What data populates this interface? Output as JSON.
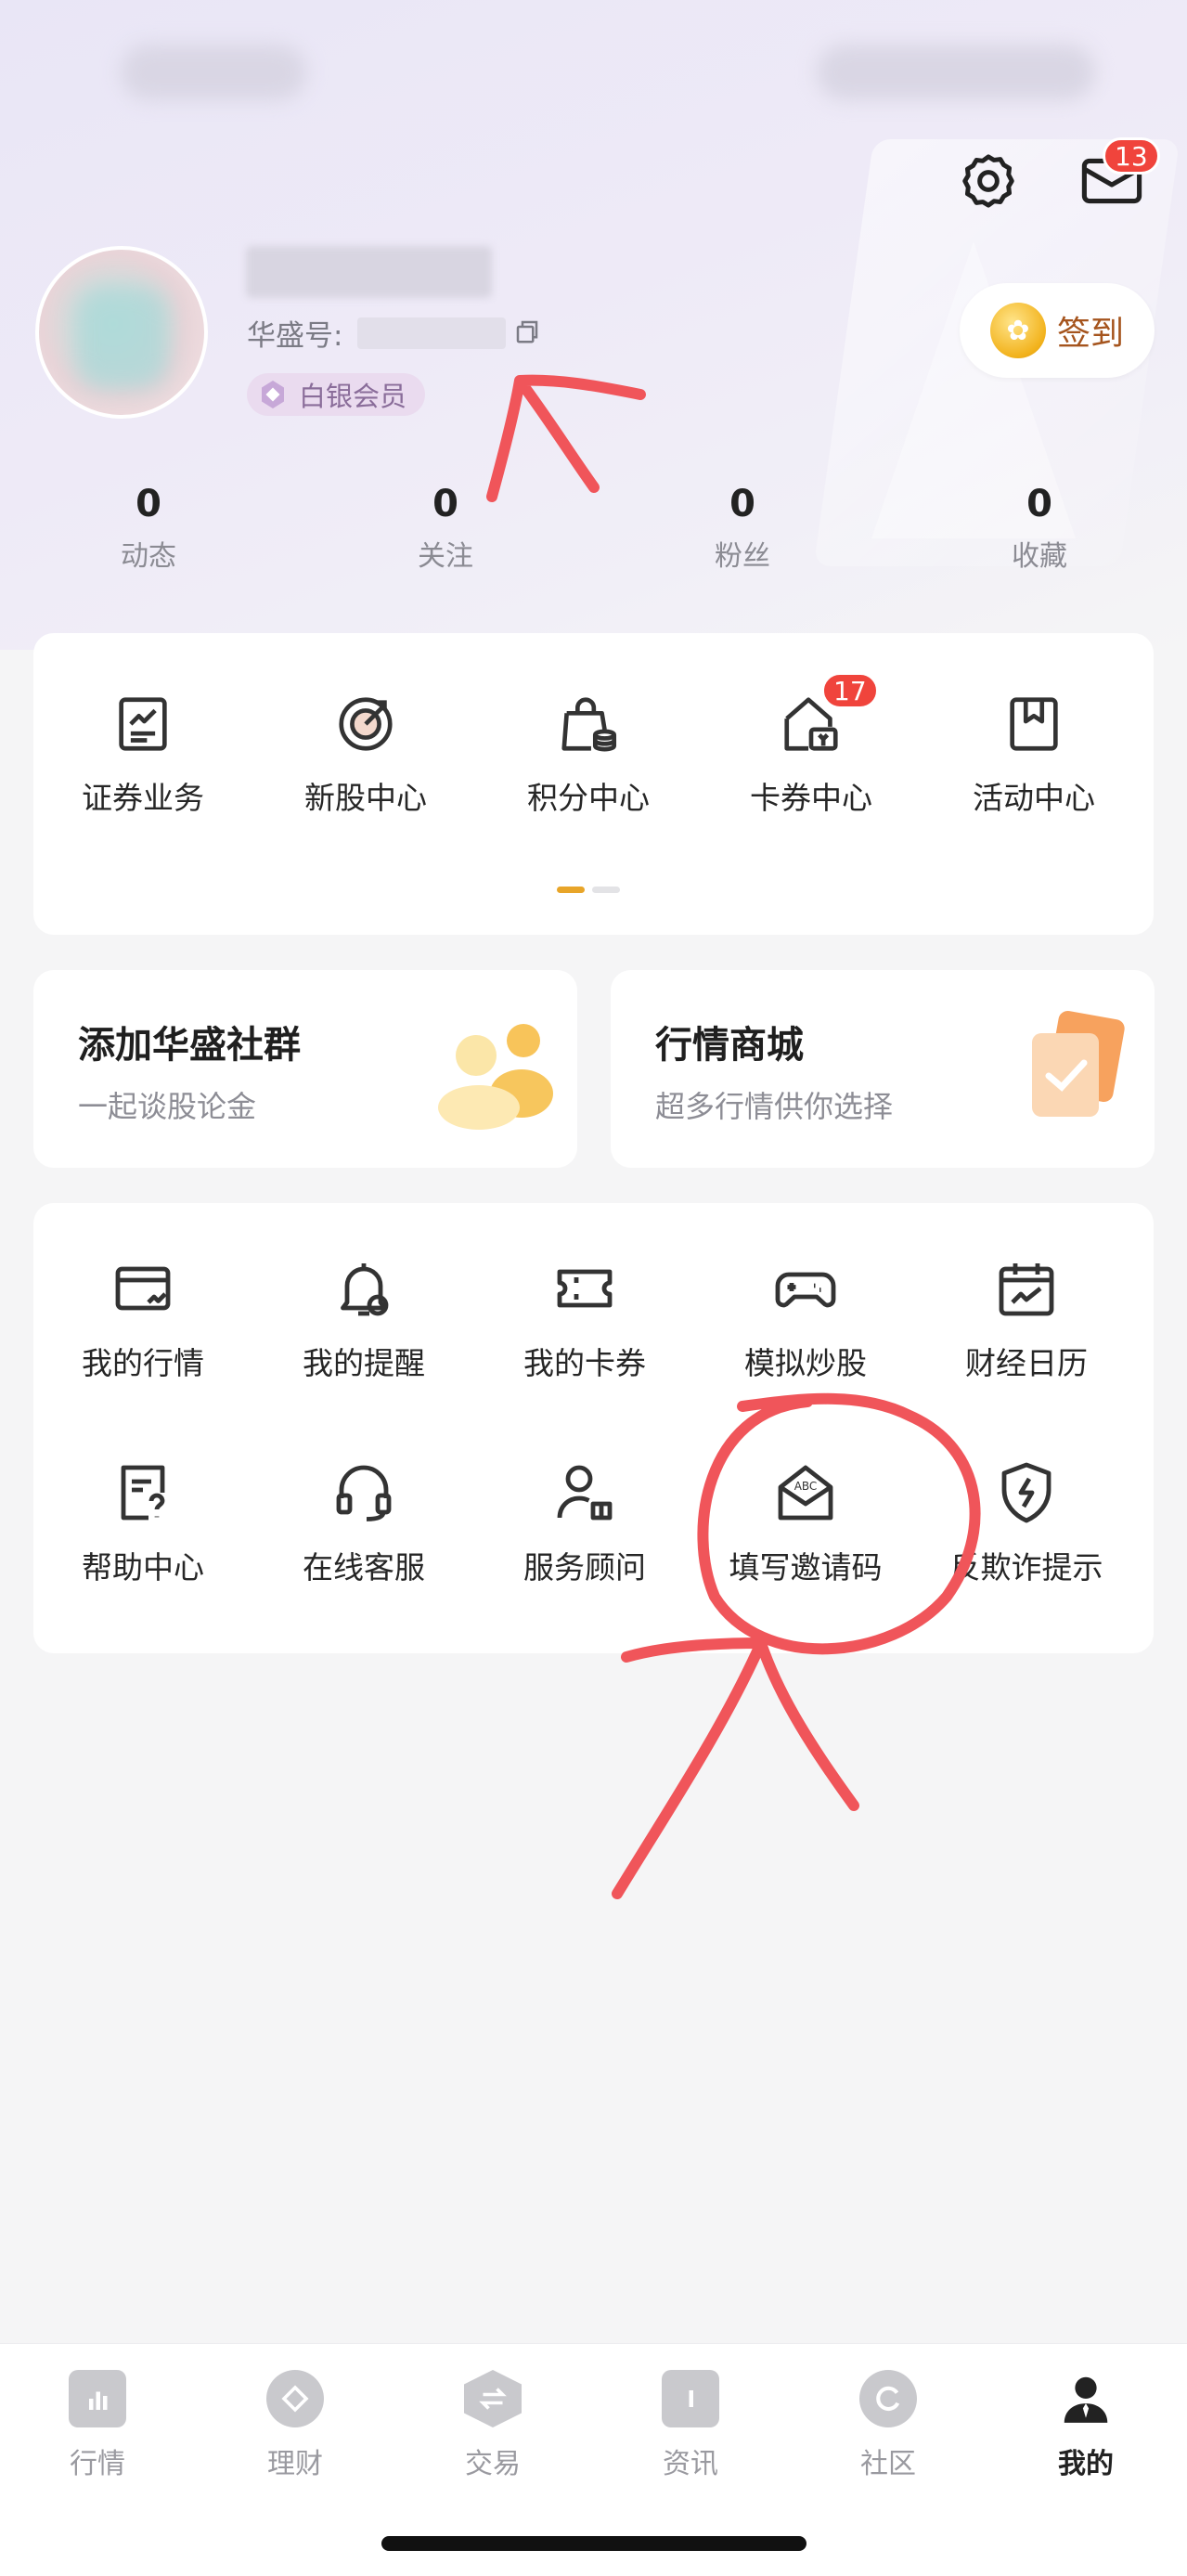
{
  "header": {
    "settings_icon": "gear-icon",
    "mail_icon": "mail-icon",
    "mail_badge": "13"
  },
  "profile": {
    "id_label": "华盛号:",
    "member_level": "白银会员",
    "checkin_label": "签到",
    "stats": [
      {
        "value": "0",
        "label": "动态"
      },
      {
        "value": "0",
        "label": "关注"
      },
      {
        "value": "0",
        "label": "粉丝"
      },
      {
        "value": "0",
        "label": "收藏"
      }
    ]
  },
  "services": {
    "items": [
      {
        "label": "证券业务",
        "icon": "document-chart-icon"
      },
      {
        "label": "新股中心",
        "icon": "target-icon"
      },
      {
        "label": "积分中心",
        "icon": "shopping-bag-icon"
      },
      {
        "label": "卡券中心",
        "icon": "ticket-house-icon",
        "badge": "17"
      },
      {
        "label": "活动中心",
        "icon": "bookmark-icon"
      }
    ]
  },
  "promos": [
    {
      "title": "添加华盛社群",
      "subtitle": "一起谈股论金",
      "icon": "group-chat-icon"
    },
    {
      "title": "行情商城",
      "subtitle": "超多行情供你选择",
      "icon": "market-cards-icon"
    }
  ],
  "tools": {
    "row1": [
      {
        "label": "我的行情",
        "icon": "market-card-icon"
      },
      {
        "label": "我的提醒",
        "icon": "bell-icon"
      },
      {
        "label": "我的卡券",
        "icon": "coupon-icon"
      },
      {
        "label": "模拟炒股",
        "icon": "gamepad-icon"
      },
      {
        "label": "财经日历",
        "icon": "calendar-chart-icon"
      }
    ],
    "row2": [
      {
        "label": "帮助中心",
        "icon": "help-document-icon"
      },
      {
        "label": "在线客服",
        "icon": "headset-icon"
      },
      {
        "label": "服务顾问",
        "icon": "advisor-icon"
      },
      {
        "label": "填写邀请码",
        "icon": "invite-envelope-icon",
        "envelope_text": "ABC"
      },
      {
        "label": "反欺诈提示",
        "icon": "shield-icon"
      }
    ]
  },
  "tabbar": [
    {
      "label": "行情",
      "icon": "chart-tab-icon"
    },
    {
      "label": "理财",
      "icon": "diamond-tab-icon"
    },
    {
      "label": "交易",
      "icon": "exchange-tab-icon"
    },
    {
      "label": "资讯",
      "icon": "news-tab-icon"
    },
    {
      "label": "社区",
      "icon": "community-tab-icon"
    },
    {
      "label": "我的",
      "icon": "profile-tab-icon",
      "active": true
    }
  ],
  "colors": {
    "accent": "#e8a529",
    "badge": "#f0443c",
    "annotation": "#f0555a",
    "member_bg": "#eadbef"
  }
}
